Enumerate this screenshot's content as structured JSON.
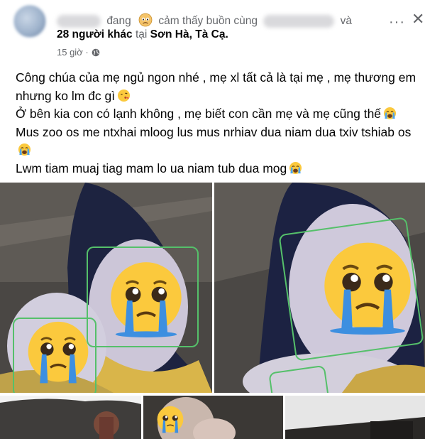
{
  "header": {
    "status_word": "đang",
    "feeling_text": "cảm thấy buồn cùng",
    "and_word": "và",
    "others_text": "28 người khác",
    "at_word": "tại",
    "location": "Sơn Hà, Tà Cạ.",
    "timestamp": "15 giờ ·",
    "more_label": "···",
    "close_label": "✕"
  },
  "icons": {
    "feeling": "sad-face-icon",
    "privacy": "globe-icon",
    "emoji": "crying-face-icon"
  },
  "post": {
    "line1": "Công chúa của mẹ ngủ ngon nhé , mẹ xl tất cả là tại mẹ , mẹ thương em nhưng ko lm đc gì",
    "line2": "Ở bên kia con có lạnh không , mẹ biết con cần mẹ và mẹ cũng thế",
    "line3": "Mus zoo os me ntxhai mloog lus mus nrhiav dua niam dua txiv tshiab os",
    "line4": "Lwm tiam muaj tiag mam lo ua niam tub dua mog"
  },
  "colors": {
    "secondary_text": "#65676b",
    "primary_text": "#050505",
    "face_box": "#55c06a",
    "emoji_yellow": "#fbc93d"
  }
}
